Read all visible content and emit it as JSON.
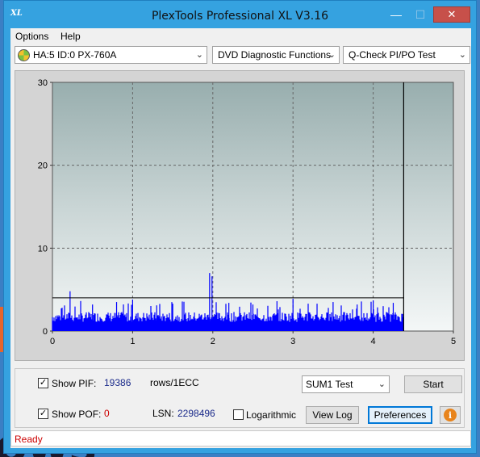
{
  "desktop": {
    "background_text": "ows"
  },
  "window": {
    "title": "PlexTools Professional XL V3.16",
    "app_icon_text": "XL",
    "minimize": "—",
    "maximize": "☐",
    "close": "✕"
  },
  "menu": {
    "options": "Options",
    "help": "Help"
  },
  "toolbar": {
    "drive": "HA:5 ID:0  PX-760A",
    "function": "DVD Diagnostic Functions",
    "test": "Q-Check PI/PO Test",
    "arrow": "⌄"
  },
  "chart_data": {
    "type": "bar",
    "x_ticks": [
      "0",
      "1",
      "2",
      "3",
      "4",
      "5"
    ],
    "y_ticks": [
      "0",
      "10",
      "20",
      "30"
    ],
    "xlim": [
      0,
      5
    ],
    "ylim": [
      0,
      30
    ],
    "grid": true,
    "series_color": "#0000ff",
    "threshold_line": 4,
    "end_marker_x": 4.38,
    "data_end_x": 4.38,
    "baseline_level": 2,
    "spikes": [
      {
        "x": 0.22,
        "y": 4.8
      },
      {
        "x": 0.5,
        "y": 3.2
      },
      {
        "x": 0.8,
        "y": 3.5
      },
      {
        "x": 1.0,
        "y": 3.8
      },
      {
        "x": 1.3,
        "y": 3.1
      },
      {
        "x": 1.5,
        "y": 3.3
      },
      {
        "x": 1.96,
        "y": 7.0
      },
      {
        "x": 1.99,
        "y": 6.6
      },
      {
        "x": 2.2,
        "y": 3.4
      },
      {
        "x": 2.5,
        "y": 3.2
      },
      {
        "x": 2.8,
        "y": 3.6
      },
      {
        "x": 3.0,
        "y": 3.9
      },
      {
        "x": 3.3,
        "y": 3.3
      },
      {
        "x": 3.5,
        "y": 3.5
      },
      {
        "x": 3.8,
        "y": 3.2
      },
      {
        "x": 4.0,
        "y": 3.7
      },
      {
        "x": 4.25,
        "y": 3.4
      }
    ]
  },
  "bottom": {
    "show_pif_label": "Show PIF:",
    "pif_value": "19386",
    "pif_unit": "rows/1ECC",
    "show_pof_label": "Show POF:",
    "pof_value": "0",
    "lsn_label": "LSN:",
    "lsn_value": "2298496",
    "log_label": "Logarithmic",
    "sum_select": "SUM1 Test",
    "start_button": "Start",
    "view_log_button": "View Log",
    "preferences_button": "Preferences",
    "info_icon": "i",
    "check_mark": "✓"
  },
  "status": {
    "text": "Ready"
  }
}
